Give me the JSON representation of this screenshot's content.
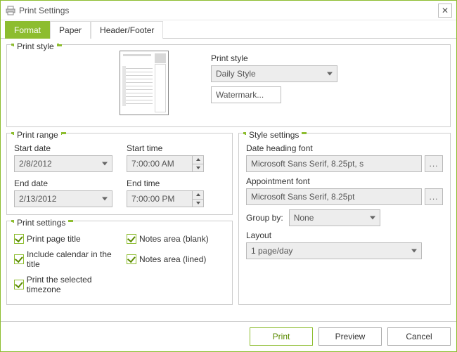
{
  "window": {
    "title": "Print Settings"
  },
  "tabs": {
    "format": "Format",
    "paper": "Paper",
    "header_footer": "Header/Footer"
  },
  "print_style": {
    "legend": "Print style",
    "label": "Print style",
    "value": "Daily Style",
    "watermark_btn": "Watermark..."
  },
  "print_range": {
    "legend": "Print range",
    "start_date_label": "Start date",
    "start_date": "2/8/2012",
    "start_time_label": "Start time",
    "start_time": "7:00:00 AM",
    "end_date_label": "End date",
    "end_date": "2/13/2012",
    "end_time_label": "End time",
    "end_time": "7:00:00 PM"
  },
  "print_settings": {
    "legend": "Print settings",
    "page_title": "Print page title",
    "include_calendar": "Include calendar in the title",
    "selected_tz": "Print the selected timezone",
    "notes_blank": "Notes area (blank)",
    "notes_lined": "Notes area (lined)"
  },
  "style_settings": {
    "legend": "Style settings",
    "date_font_label": "Date heading font",
    "date_font": "Microsoft Sans Serif, 8.25pt, s",
    "appt_font_label": "Appointment font",
    "appt_font": "Microsoft Sans Serif, 8.25pt",
    "group_by_label": "Group by:",
    "group_by": "None",
    "layout_label": "Layout",
    "layout": "1 page/day",
    "dots": "..."
  },
  "footer": {
    "print": "Print",
    "preview": "Preview",
    "cancel": "Cancel"
  }
}
